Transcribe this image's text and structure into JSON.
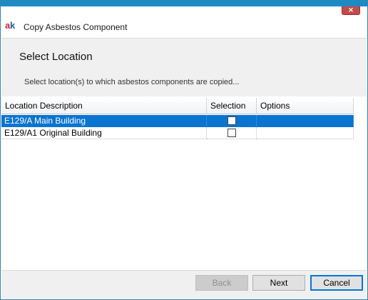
{
  "window": {
    "title": "Copy Asbestos Component",
    "logo_text": "ak",
    "close_label": "✕"
  },
  "header": {
    "heading": "Select Location",
    "description": "Select location(s) to which asbestos components are copied..."
  },
  "grid": {
    "columns": [
      "Location Description",
      "Selection",
      "Options"
    ],
    "rows": [
      {
        "location": "E129/A Main Building",
        "selected": false,
        "options": "",
        "highlighted": true
      },
      {
        "location": "E129/A1 Original Building",
        "selected": false,
        "options": "",
        "highlighted": false
      }
    ]
  },
  "footer": {
    "back_label": "Back",
    "next_label": "Next",
    "cancel_label": "Cancel"
  },
  "colors": {
    "accent": "#1c8bc4",
    "row_highlight": "#0a74d1",
    "close_button": "#c44b4b",
    "panel_bg": "#f0f0f0"
  },
  "icons": [
    "app-logo-icon",
    "close-icon",
    "checkbox-icon"
  ]
}
